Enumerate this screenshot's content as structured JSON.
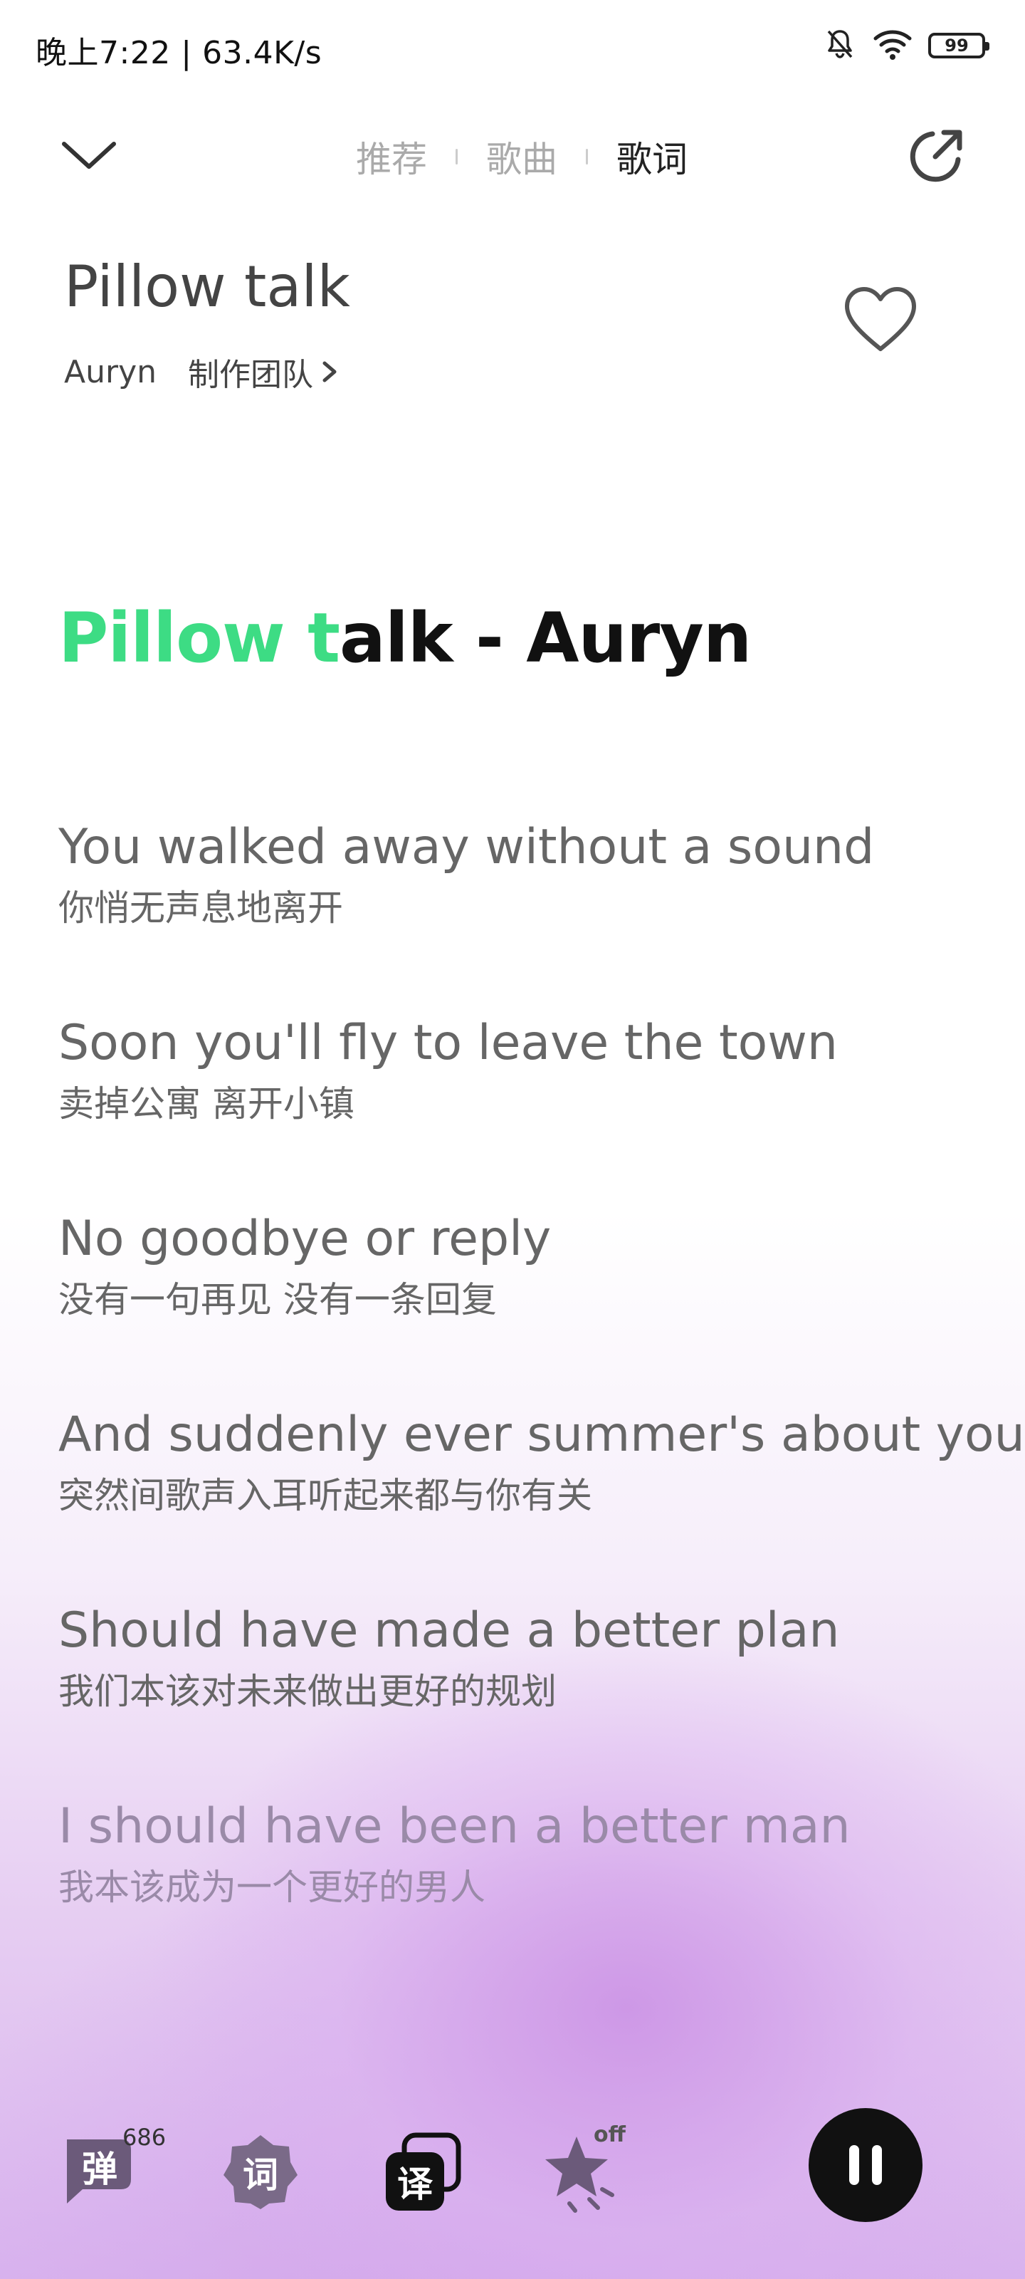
{
  "status_bar": {
    "time_speed": "晚上7:22 | 63.4K/s",
    "battery": "99"
  },
  "header": {
    "tabs": [
      {
        "label": "推荐",
        "active": false
      },
      {
        "label": "歌曲",
        "active": false
      },
      {
        "label": "歌词",
        "active": true
      }
    ]
  },
  "song": {
    "title": "Pillow talk",
    "artist": "Auryn",
    "credits_label": "制作团队",
    "liked": false
  },
  "lyrics": {
    "heading_highlight": "Pillow t",
    "heading_rest": "alk - Auryn",
    "lines": [
      {
        "en": "You walked away without a sound",
        "zh": "你悄无声息地离开"
      },
      {
        "en": "Soon you'll fly to leave the town",
        "zh": "卖掉公寓 离开小镇"
      },
      {
        "en": "No goodbye or reply",
        "zh": "没有一句再见 没有一条回复"
      },
      {
        "en": "And suddenly ever summer's about you",
        "zh": "突然间歌声入耳听起来都与你有关"
      },
      {
        "en": "Should have made a better plan",
        "zh": "我们本该对未来做出更好的规划"
      },
      {
        "en": "I should have been a better man",
        "zh": "我本该成为一个更好的男人"
      }
    ]
  },
  "toolbar": {
    "danmu": {
      "label": "弹",
      "count": "686"
    },
    "lyric_style": {
      "label": "词"
    },
    "translate": {
      "label": "译"
    },
    "star": {
      "badge": "off"
    }
  },
  "player": {
    "state": "playing"
  },
  "colors": {
    "accent_green": "#3ddc84",
    "bg_gradient_purple": "#d9b4ee",
    "pause_button": "#111111"
  }
}
